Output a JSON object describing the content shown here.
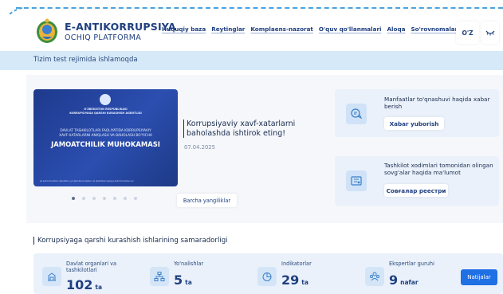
{
  "brand": {
    "title": "E-ANTIKORRUPSIYA",
    "subtitle": "OCHIQ PLATFORMA"
  },
  "nav": [
    {
      "label": "Huquqiy baza"
    },
    {
      "label": "Reytinglar"
    },
    {
      "label": "Komplaens-nazorat"
    },
    {
      "label": "O'quv qo'llanmalari"
    },
    {
      "label": "Aloqa"
    },
    {
      "label": "So'rovnomalar"
    }
  ],
  "language": "O'Z",
  "banner": "Tizim test rejimida ishlamoqda",
  "poster": {
    "line1": "O'ZBEKISTON RESPUBLIKASI",
    "line2": "KORRUPSIYAGA QARSHI KURASHISH AGENTLIGI",
    "p1": "DAVLAT TASHKILOTLARI FAOLIYATIDA KORRUPSIYAVIY",
    "p2": "XAVF-XATARLARNI ANIQLASH VA BAHOLASH BO'YICHA",
    "main": "JAMOATCHILIK MUHOKAMASI",
    "footer": "@ anticorruption   @antikor_uz   @anticorruption.uz   @antikorrupsiya   anticorruption.uz"
  },
  "news": {
    "title": "Korrupsiyaviy xavf-xatarlarni baholashda ishtirok eting!",
    "date": "07.04.2025",
    "all_button": "Barcha yangiliklar"
  },
  "carousel": {
    "count": 7,
    "active": 0
  },
  "cards": [
    {
      "text": "Manfaatlar to'qnashuvi haqida xabar berish",
      "button": "Xabar yuborish"
    },
    {
      "text": "Tashkilot xodimlari tomonidan olingan sovg'alar haqida ma'lumot",
      "button": "Совғалар реестри"
    }
  ],
  "section_title": "Korrupsiyaga qarshi kurashish ishlarining samaradorligi",
  "stats": [
    {
      "label": "Davlat organlari va tashkilotlari",
      "value": "102",
      "unit": "ta"
    },
    {
      "label": "Yo'nalishlar",
      "value": "5",
      "unit": "ta"
    },
    {
      "label": "Indikatorlar",
      "value": "29",
      "unit": "ta"
    },
    {
      "label": "Ekspertlar guruhi",
      "value": "9",
      "unit": "nafar"
    }
  ],
  "results_button": "Natijalar",
  "colors": {
    "brand": "#1f3f80",
    "accent": "#1f6fe5",
    "banner": "#d6e9f9"
  }
}
